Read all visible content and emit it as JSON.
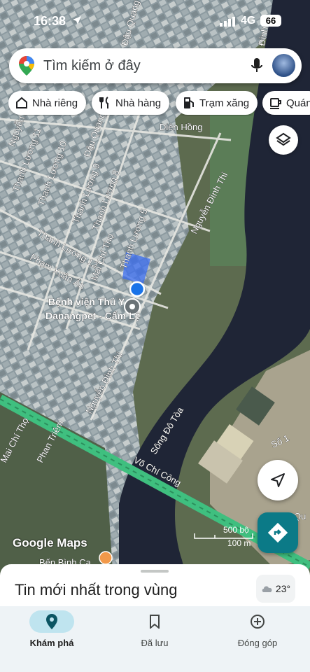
{
  "status": {
    "time": "16:38",
    "network": "4G",
    "battery": "66"
  },
  "search": {
    "placeholder": "Tìm kiếm ở đây"
  },
  "chips": [
    {
      "label": "Nhà riêng",
      "icon": "home-icon"
    },
    {
      "label": "Nhà hàng",
      "icon": "restaurant-icon"
    },
    {
      "label": "Trạm xăng",
      "icon": "gas-station-icon"
    },
    {
      "label": "Quán",
      "icon": "coffee-icon"
    }
  ],
  "map": {
    "streets": [
      "Diên Hồng",
      "Nguyễn An",
      "Thanh Lương 11",
      "Thanh Lương 10",
      "Đậu Quang",
      "Thanh Lương 9",
      "Thanh Lương 8",
      "Thanh Lương 5",
      "Nguyễn Đình Thi",
      "Thanh Lương 12",
      "Mai Chí Thọ",
      "Phạm Xuân Ẩn",
      "Nguyễn Đình Thi",
      "Phan Triêm",
      "Mai Chí Thọ",
      "Võ Chí Công",
      "Sông Đô Tòa",
      "Số 1",
      "Bến Bình Ca",
      "Đậu Quang Lĩnh",
      "Qu",
      "Đình T"
    ],
    "poi": {
      "line1": "Bệnh viện Thú Y",
      "line2": "Danangpet - Cẩm Lệ"
    },
    "attribution": "Google Maps",
    "scale": {
      "top": "500 bộ",
      "bottom": "100 m"
    }
  },
  "sheet": {
    "title": "Tin mới nhất trong vùng",
    "temperature": "23°"
  },
  "nav": [
    {
      "label": "Khám phá",
      "icon": "explore-pin-icon",
      "active": true
    },
    {
      "label": "Đã lưu",
      "icon": "bookmark-icon",
      "active": false
    },
    {
      "label": "Đóng góp",
      "icon": "add-circle-icon",
      "active": false
    }
  ],
  "colors": {
    "accent": "#1a73e8",
    "directions": "#0b7a87",
    "river": "#1f2536",
    "highway": "#3fbf7f"
  }
}
